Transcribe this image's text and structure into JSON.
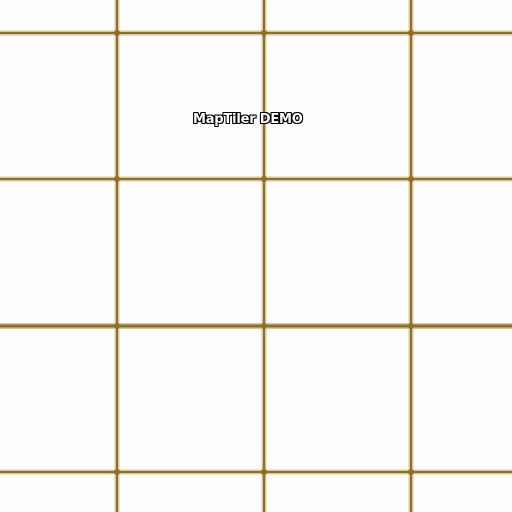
{
  "map": {
    "watermark_text": "MapTiler DEMO",
    "grid_line_color": "#8b6f2a",
    "grid_line_halo_color": "#d9c79a",
    "background_color": "#fefefe"
  }
}
